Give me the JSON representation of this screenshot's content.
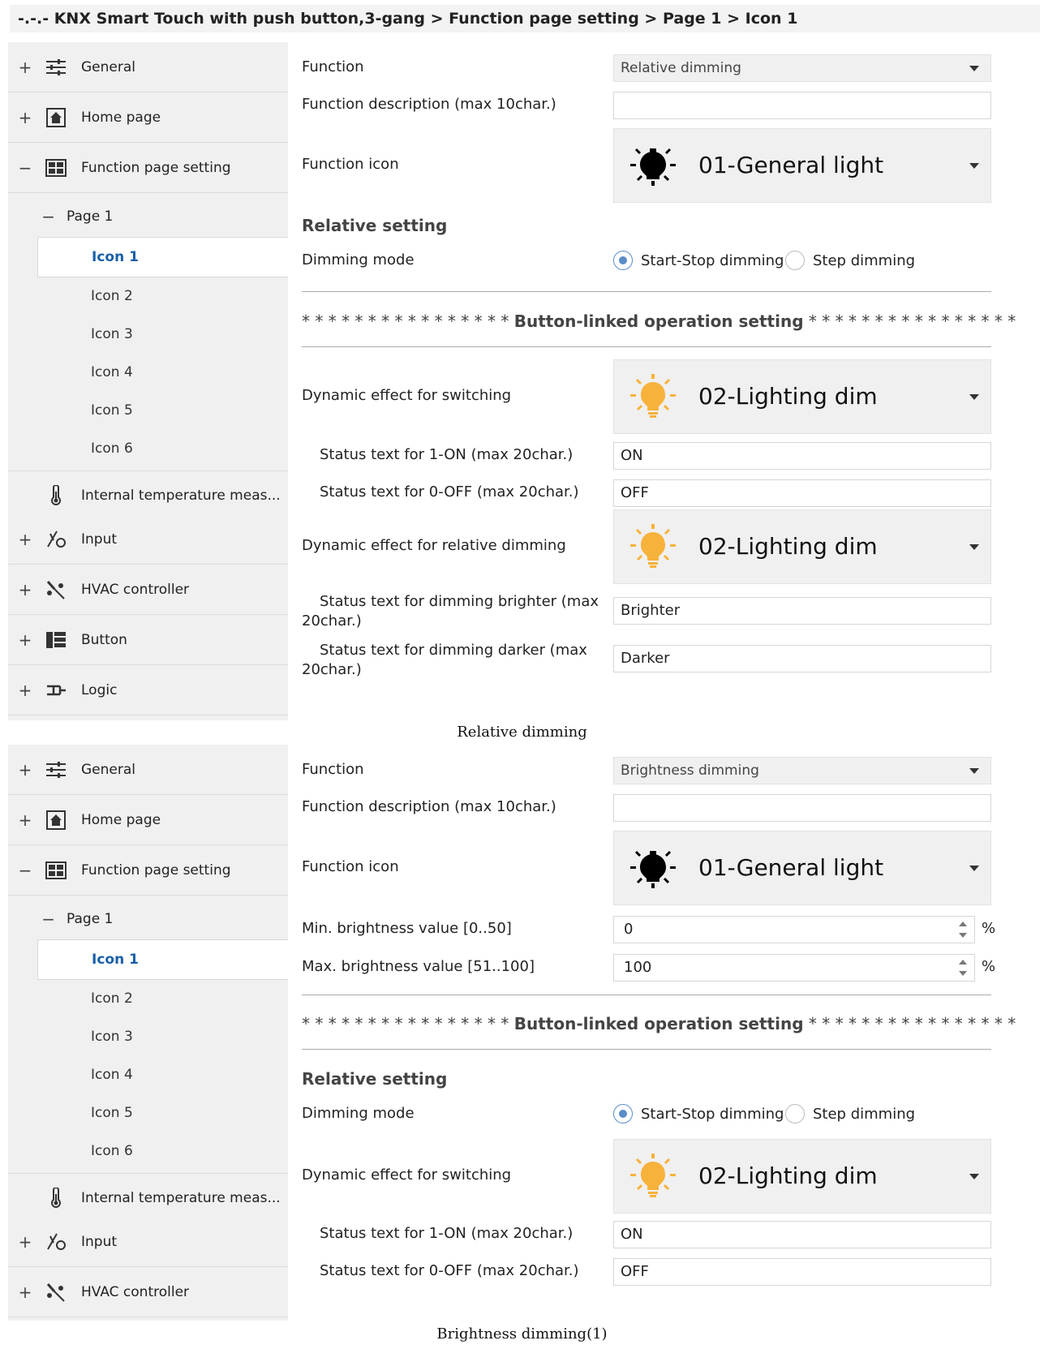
{
  "breadcrumb": "-.-.- KNX Smart Touch with push button,3-gang > Function page setting > Page 1 > Icon 1",
  "sidebar": {
    "general": "General",
    "home": "Home page",
    "function_page": "Function page setting",
    "page1": "Page 1",
    "icons": [
      "Icon 1",
      "Icon 2",
      "Icon 3",
      "Icon 4",
      "Icon 5",
      "Icon 6"
    ],
    "internal_temp": "Internal temperature meas...",
    "input": "Input",
    "hvac": "HVAC controller",
    "button": "Button",
    "logic": "Logic",
    "expand": "+",
    "collapse": "−"
  },
  "panel1": {
    "function_label": "Function",
    "function_value": "Relative dimming",
    "desc_label": "Function description (max 10char.)",
    "desc_value": "",
    "icon_label": "Function icon",
    "icon_value": "01-General light",
    "relative_setting": "Relative setting",
    "dimming_mode_label": "Dimming mode",
    "radio_start_stop": "Start-Stop dimming",
    "radio_step": "Step dimming",
    "stars_left": "* * * * * * * * * * * * * * * *",
    "button_linked": "Button-linked operation setting",
    "stars_right": "* * * * * * * * * * * * * * * *",
    "dyn_switch_label": "Dynamic effect for switching",
    "dyn_switch_value": "02-Lighting dim",
    "on_label": "Status text for 1-ON (max 20char.)",
    "on_value": "ON",
    "off_label": "Status text for 0-OFF (max 20char.)",
    "off_value": "OFF",
    "dyn_rel_label": "Dynamic effect  for relative dimming",
    "dyn_rel_value": "02-Lighting dim",
    "brighter_label": "Status text for dimming brighter (max 20char.)",
    "brighter_value": "Brighter",
    "darker_label": "Status text for dimming darker (max 20char.)",
    "darker_value": "Darker"
  },
  "caption1": "Relative dimming",
  "panel2": {
    "function_label": "Function",
    "function_value": "Brightness dimming",
    "desc_label": "Function description (max 10char.)",
    "desc_value": "",
    "icon_label": "Function icon",
    "icon_value": "01-General light",
    "min_label": "Min. brightness value [0..50]",
    "min_value": "0",
    "max_label": "Max. brightness value [51..100]",
    "max_value": "100",
    "unit": "%",
    "stars_left": "* * * * * * * * * * * * * * * *",
    "button_linked": "Button-linked operation setting",
    "stars_right": "* * * * * * * * * * * * * * * *",
    "relative_setting": "Relative setting",
    "dimming_mode_label": "Dimming mode",
    "radio_start_stop": "Start-Stop dimming",
    "radio_step": "Step dimming",
    "dyn_switch_label": "Dynamic effect for switching",
    "dyn_switch_value": "02-Lighting dim",
    "on_label": "Status text for 1-ON (max 20char.)",
    "on_value": "ON",
    "off_label": "Status text for 0-OFF (max 20char.)",
    "off_value": "OFF"
  },
  "caption2": "Brightness dimming(1)",
  "colors": {
    "accent": "#1a5fa8",
    "bulb_on": "#f7b23b",
    "radio": "#5a8cc8"
  }
}
